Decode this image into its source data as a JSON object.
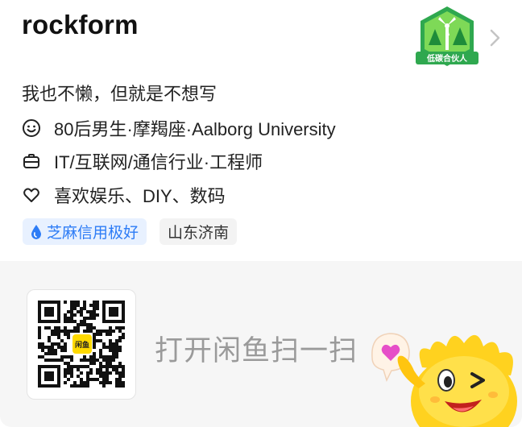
{
  "profile": {
    "username": "rockform",
    "bio": "我也不懒，但就是不想写",
    "badge_label": "低碳合伙人",
    "info": [
      {
        "icon": "smiley-icon",
        "text": "80后男生·摩羯座·Aalborg University"
      },
      {
        "icon": "briefcase-icon",
        "text": "IT/互联网/通信行业·工程师"
      },
      {
        "icon": "heart-outline-icon",
        "text": "喜欢娱乐、DIY、数码"
      }
    ],
    "tags": {
      "credit": "芝麻信用极好",
      "location": "山东济南"
    }
  },
  "qr": {
    "logo_text": "闲鱼",
    "scan_prompt": "打开闲鱼扫一扫"
  },
  "colors": {
    "credit_blue": "#2d7cf6",
    "badge_green": "#3cb54a",
    "mascot_yellow": "#ffd21f"
  }
}
